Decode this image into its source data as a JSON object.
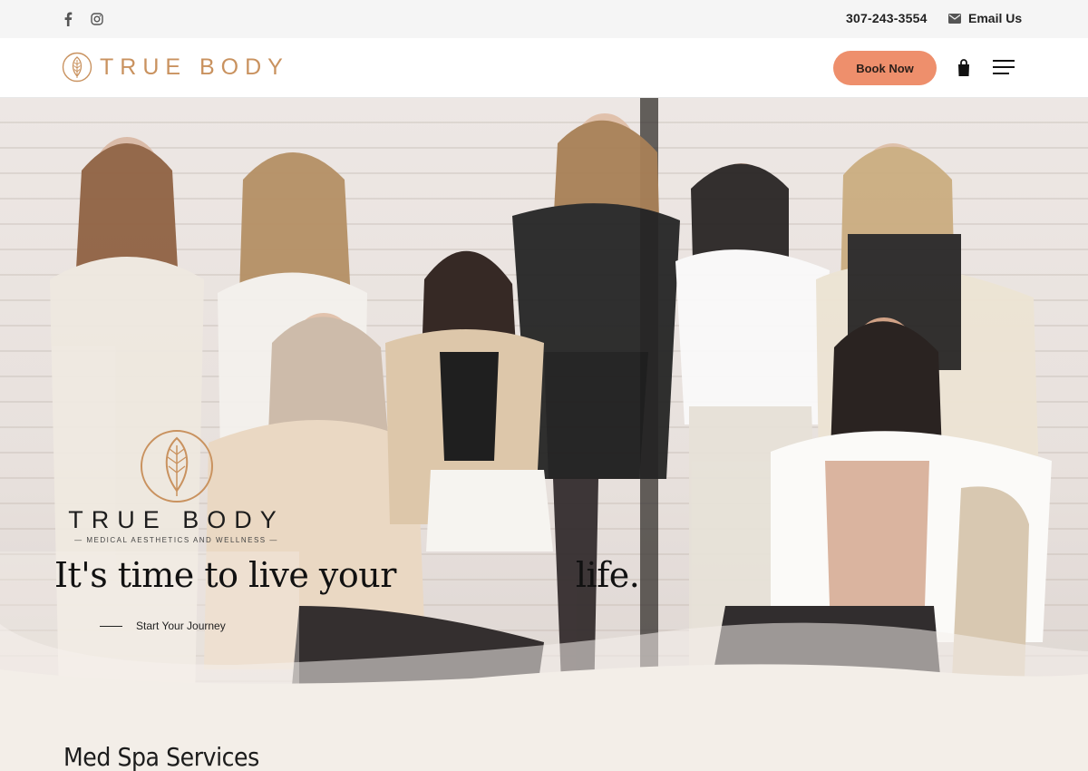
{
  "topbar": {
    "social": [
      {
        "name": "facebook-icon",
        "glyph": "f"
      },
      {
        "name": "instagram-icon",
        "glyph": ""
      }
    ],
    "phone": "307-243-3554",
    "email_label": "Email Us"
  },
  "header": {
    "logo_text": "TRUE BODY",
    "book_label": "Book Now",
    "cart_icon": "shopping-bag-icon",
    "menu_icon": "hamburger-menu-icon"
  },
  "hero": {
    "logo_name": "TRUE BODY",
    "logo_tagline": "— MEDICAL AESTHETICS AND WELLNESS —",
    "headline_start": "It's time to live your",
    "headline_end": "life.",
    "cta_label": "Start Your Journey"
  },
  "services": {
    "title": "Med Spa Services"
  },
  "colors": {
    "accent": "#ee8f6c",
    "brand_gold": "#c9925f",
    "page_bg": "#f3eee8"
  }
}
